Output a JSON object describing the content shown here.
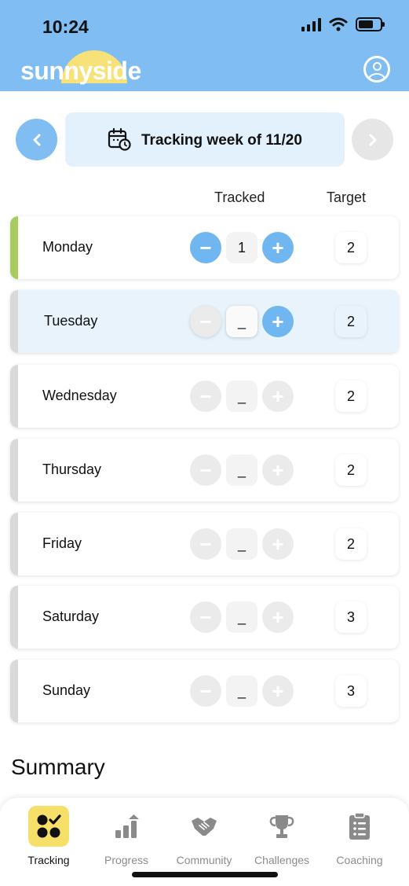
{
  "status": {
    "time": "10:24"
  },
  "brand": {
    "name": "sunnyside"
  },
  "week": {
    "title": "Tracking week of 11/20"
  },
  "columns": {
    "tracked": "Tracked",
    "target": "Target"
  },
  "days": [
    {
      "name": "Monday",
      "tracked": "1",
      "target": "2"
    },
    {
      "name": "Tuesday",
      "tracked": "_",
      "target": "2"
    },
    {
      "name": "Wednesday",
      "tracked": "_",
      "target": "2"
    },
    {
      "name": "Thursday",
      "tracked": "_",
      "target": "2"
    },
    {
      "name": "Friday",
      "tracked": "_",
      "target": "2"
    },
    {
      "name": "Saturday",
      "tracked": "_",
      "target": "3"
    },
    {
      "name": "Sunday",
      "tracked": "_",
      "target": "3"
    }
  ],
  "summary": {
    "title": "Summary"
  },
  "tabs": [
    {
      "label": "Tracking"
    },
    {
      "label": "Progress"
    },
    {
      "label": "Community"
    },
    {
      "label": "Challenges"
    },
    {
      "label": "Coaching"
    }
  ],
  "colors": {
    "header": "#7fbdf2",
    "accent_blue": "#70b6f0",
    "monday_accent": "#a8cc60",
    "active_tab": "#f7e06a"
  }
}
